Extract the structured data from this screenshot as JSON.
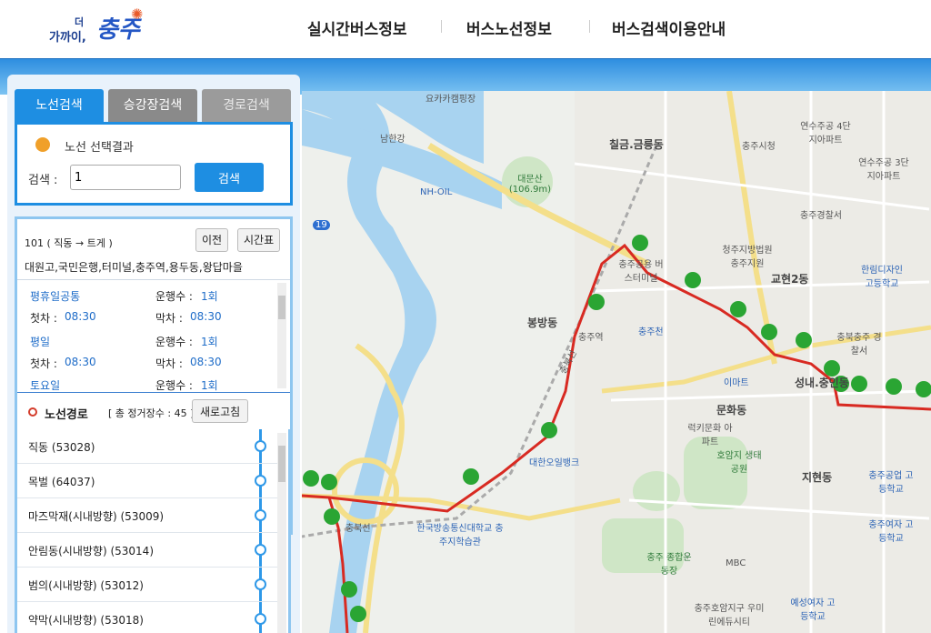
{
  "header": {
    "logo_small": "가까이,",
    "logo_small_top": "더",
    "logo_big": "충주",
    "nav": [
      "실시간버스정보",
      "버스노선정보",
      "버스검색이용안내"
    ]
  },
  "tabs": [
    "노선검색",
    "승강장검색",
    "경로검색"
  ],
  "search": {
    "result_label": "노선 선택결과",
    "label": "검색 :",
    "value": "1",
    "button": "검색"
  },
  "route": {
    "title": "101 ( 직동 → 트게 )",
    "prev_button": "이전",
    "timetable_button": "시간표",
    "stops_summary": "대원고,국민은행,터미널,충주역,용두동,왕답마을",
    "schedule": [
      {
        "day": "평휴일공통",
        "runs_label": "운행수 : ",
        "runs": "1회",
        "first_label": "첫차 :",
        "first": "08:30",
        "last_label": "막차 :",
        "last": "08:30"
      },
      {
        "day": "평일",
        "runs_label": "운행수 : ",
        "runs": "1회",
        "first_label": "첫차 :",
        "first": "08:30",
        "last_label": "막차 :",
        "last": "08:30"
      },
      {
        "day": "토요일",
        "runs_label": "운행수 : ",
        "runs": "1회"
      }
    ]
  },
  "path": {
    "title": "노선경로",
    "count": "[ 총 정거장수 : 45 ]",
    "refresh_button": "새로고침",
    "stops": [
      "직동 (53028)",
      "목벌 (64037)",
      "마즈막재(시내방향) (53009)",
      "안림동(시내방향) (53014)",
      "범의(시내방향) (53012)",
      "약막(시내방향) (53018)"
    ]
  },
  "map": {
    "labels": [
      {
        "text": "요카카캠핑장",
        "cls": ""
      },
      {
        "text": "남한강",
        "cls": ""
      },
      {
        "text": "칠금.금릉동",
        "cls": "big"
      },
      {
        "text": "충주시청",
        "cls": ""
      },
      {
        "text": "연수주공 4단지아파트",
        "cls": ""
      },
      {
        "text": "연수주공 3단지아파트",
        "cls": ""
      },
      {
        "text": "대문산 (106.9m)",
        "cls": "green"
      },
      {
        "text": "NH-OIL",
        "cls": "blue"
      },
      {
        "text": "충주경찰서",
        "cls": ""
      },
      {
        "text": "충주공용 버스터미널",
        "cls": ""
      },
      {
        "text": "청주지방법원 충주지원",
        "cls": ""
      },
      {
        "text": "교현2동",
        "cls": "big"
      },
      {
        "text": "한림디자인 고등학교",
        "cls": "blue"
      },
      {
        "text": "봉방동",
        "cls": "big"
      },
      {
        "text": "충주역",
        "cls": ""
      },
      {
        "text": "충주천",
        "cls": "blue"
      },
      {
        "text": "충북충주 경찰서",
        "cls": ""
      },
      {
        "text": "성내.충인동",
        "cls": "big"
      },
      {
        "text": "이마트",
        "cls": "blue"
      },
      {
        "text": "문화동",
        "cls": "big"
      },
      {
        "text": "럭키문화 아파트",
        "cls": ""
      },
      {
        "text": "대한오일뱅크",
        "cls": "blue"
      },
      {
        "text": "호암지 생태공원",
        "cls": "green"
      },
      {
        "text": "지현동",
        "cls": "big"
      },
      {
        "text": "충주공업 고등학교",
        "cls": "blue"
      },
      {
        "text": "충주여자 고등학교",
        "cls": "blue"
      },
      {
        "text": "한국방송통신대학교 충주지학습관",
        "cls": "blue"
      },
      {
        "text": "충북선",
        "cls": ""
      },
      {
        "text": "충주 종합운동장",
        "cls": "green"
      },
      {
        "text": "MBC",
        "cls": ""
      },
      {
        "text": "예성여자 고등학교",
        "cls": "blue"
      },
      {
        "text": "충주호암지구 우미린에듀시티",
        "cls": ""
      },
      {
        "text": "충북선",
        "cls": ""
      },
      {
        "text": "19",
        "cls": ""
      }
    ]
  }
}
